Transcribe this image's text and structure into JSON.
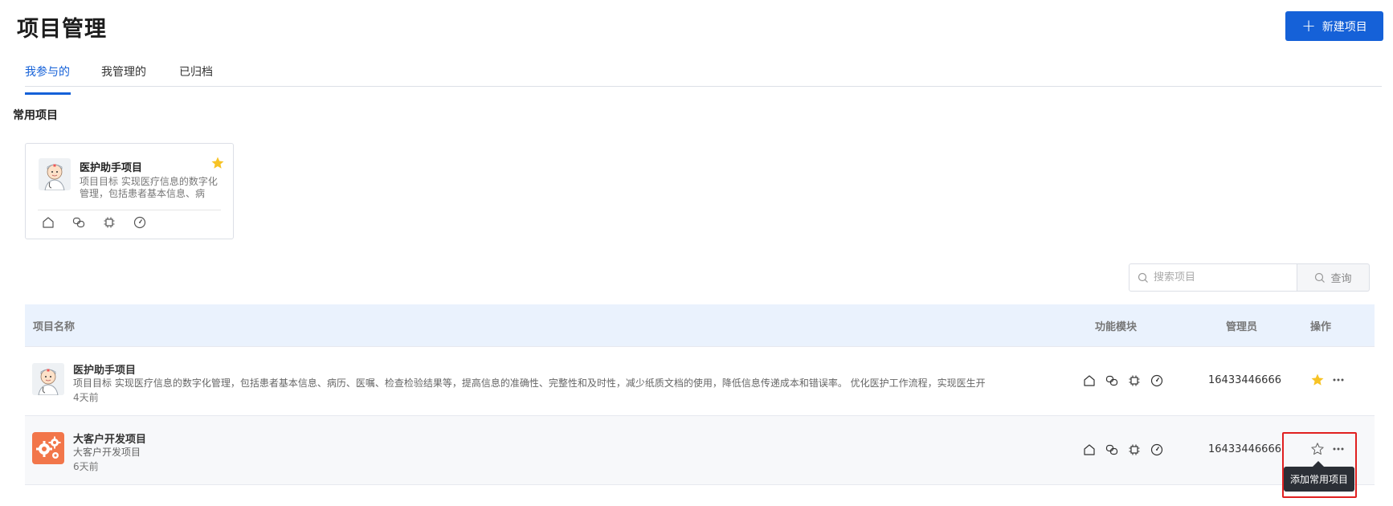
{
  "page": {
    "title": "项目管理"
  },
  "header": {
    "new_button_label": "新建项目"
  },
  "tabs": [
    {
      "label": "我参与的",
      "active": true
    },
    {
      "label": "我管理的",
      "active": false
    },
    {
      "label": "已归档",
      "active": false
    }
  ],
  "favorites": {
    "section_title": "常用项目",
    "cards": [
      {
        "name": "医护助手项目",
        "description": "项目目标 实现医疗信息的数字化管理，包括患者基本信息、病",
        "starred": true,
        "avatar": "doctor-avatar",
        "modules": [
          "home-icon",
          "link-icon",
          "chip-icon",
          "gauge-icon"
        ]
      }
    ]
  },
  "search": {
    "placeholder": "搜索项目",
    "value": "",
    "query_button_label": "查询"
  },
  "table": {
    "columns": [
      "项目名称",
      "功能模块",
      "管理员",
      "操作"
    ],
    "rows": [
      {
        "name": "医护助手项目",
        "description": "项目目标 实现医疗信息的数字化管理，包括患者基本信息、病历、医嘱、检查检验结果等，提高信息的准确性、完整性和及时性，减少纸质文档的使用，降低信息传递成本和错误率。 优化医护工作流程，实现医生开",
        "time": "4天前",
        "admin": "16433446666",
        "starred": true,
        "avatar": "doctor-avatar",
        "modules": [
          "home-icon",
          "link-icon",
          "chip-icon",
          "gauge-icon"
        ]
      },
      {
        "name": "大客户开发项目",
        "description": "大客户开发项目",
        "time": "6天前",
        "admin": "16433446666",
        "starred": false,
        "avatar": "gears-avatar",
        "modules": [
          "home-icon",
          "link-icon",
          "chip-icon",
          "gauge-icon"
        ]
      }
    ]
  },
  "tooltip": {
    "text": "添加常用项目"
  },
  "colors": {
    "primary": "#1561d8",
    "star": "#f7c325",
    "header_bg": "#eaf2fd",
    "highlight": "#e02020",
    "avatar_orange": "#f2764a"
  }
}
